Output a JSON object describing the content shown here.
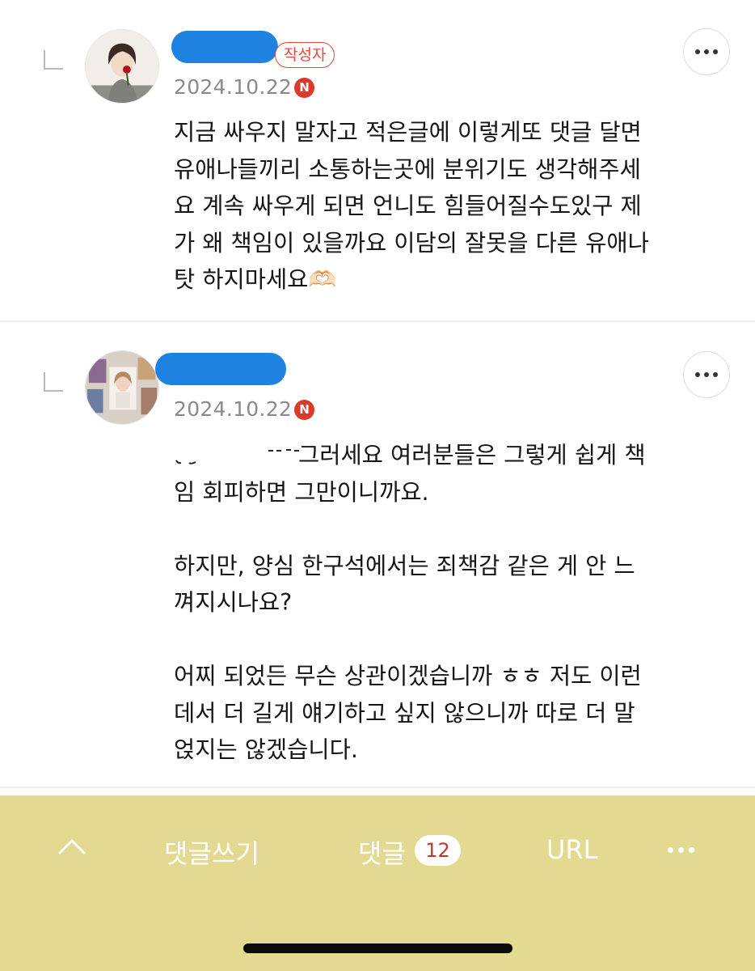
{
  "comments": [
    {
      "author_badge": "작성자",
      "date": "2024.10.22",
      "new_badge": "N",
      "text": "지금 싸우지 말자고 적은글에 이렇게또 댓글 달면\n유애나들끼리 소통하는곳에 분위기도 생각해주세\n요 계속 싸우게 되면 언니도 힘들어질수도있구 제\n가 왜 책임이 있을까요 이담의 잘못을 다른 유애나\n탓 하지마세요🫶🏻"
    },
    {
      "date": "2024.10.22",
      "new_badge": "N",
      "text": "                 그러세요 여러분들은 그렇게 쉽게 책\n임 회피하면 그만이니까요.\n\n하지만, 양심 한구석에서는 죄책감 같은 게 안 느\n껴지시나요?\n\n어찌 되었든 무슨 상관이겠습니까 ㅎㅎ 저도 이런\n데서 더 길게 얘기하고 싶지 않으니까 따로 더 말\n얹지는 않겠습니다."
    }
  ],
  "bottom_bar": {
    "write_label": "댓글쓰기",
    "comments_label": "댓글",
    "comments_count": "12",
    "url_label": "URL"
  },
  "colors": {
    "bottom_bar_bg": "#e3d990",
    "name_redaction": "#1d82e0",
    "new_badge": "#d93a2b",
    "author_badge": "#e24a3a"
  },
  "icons": [
    "reply-arrow-icon",
    "more-options-icon",
    "chevron-up-icon",
    "new-badge-icon"
  ]
}
